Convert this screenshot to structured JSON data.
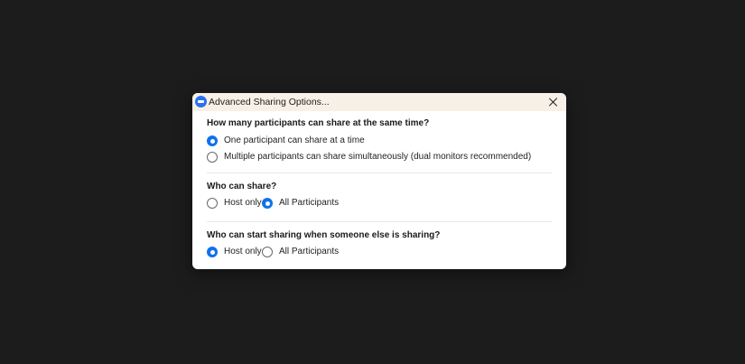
{
  "window": {
    "title": "Advanced Sharing Options...",
    "app_icon": "zoom-app-icon",
    "close_icon": "close-icon"
  },
  "sections": [
    {
      "question": "How many participants can share at the same time?",
      "options": [
        {
          "label": "One participant can share at a time",
          "checked": true
        },
        {
          "label": "Multiple participants can share simultaneously (dual monitors recommended)",
          "checked": false
        }
      ]
    },
    {
      "question": "Who can share?",
      "options": [
        {
          "label": "Host only",
          "checked": false
        },
        {
          "label": "All Participants",
          "checked": true
        }
      ]
    },
    {
      "question": "Who can start sharing when someone else is sharing?",
      "options": [
        {
          "label": "Host only",
          "checked": true
        },
        {
          "label": "All Participants",
          "checked": false
        }
      ]
    }
  ],
  "colors": {
    "accent": "#0e72ed",
    "background": "#1c1c1c",
    "titlebar": "#f6f0e6"
  }
}
